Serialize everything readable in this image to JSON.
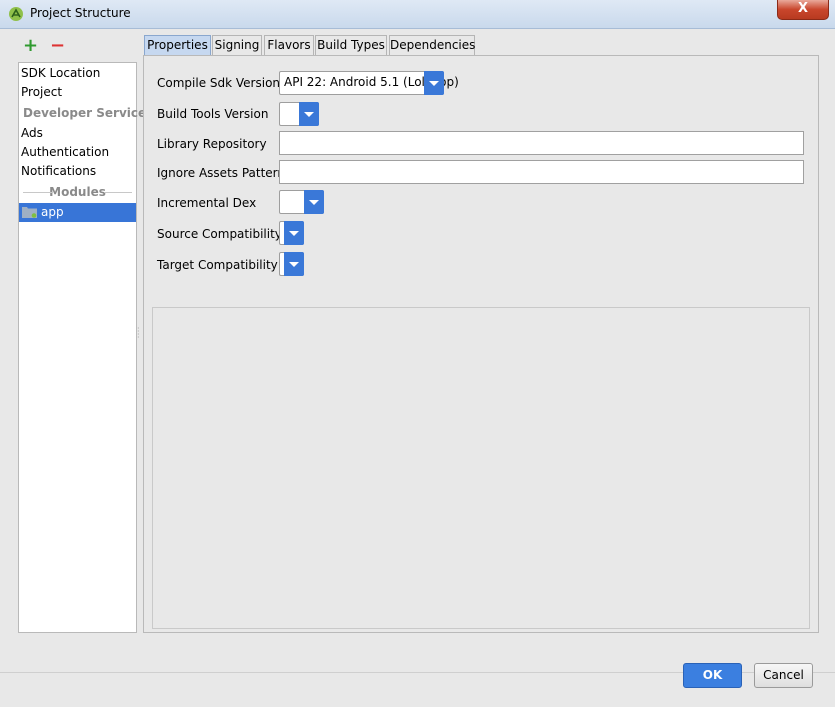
{
  "window": {
    "title": "Project Structure",
    "close_label": "X"
  },
  "toolbar": {
    "add_label": "+",
    "remove_label": "−"
  },
  "sidebar": {
    "items": [
      {
        "label": "SDK Location"
      },
      {
        "label": "Project"
      },
      {
        "label": "Developer Services"
      },
      {
        "label": "Ads"
      },
      {
        "label": "Authentication"
      },
      {
        "label": "Notifications"
      }
    ],
    "modules_header": "Modules",
    "modules": [
      {
        "label": "app",
        "selected": true
      }
    ]
  },
  "tabs": [
    {
      "label": "Properties",
      "active": true
    },
    {
      "label": "Signing"
    },
    {
      "label": "Flavors"
    },
    {
      "label": "Build Types"
    },
    {
      "label": "Dependencies"
    }
  ],
  "properties": {
    "compile_sdk": {
      "label": "Compile Sdk Version",
      "value": "API 22: Android 5.1 (Lollipop)"
    },
    "build_tools": {
      "label": "Build Tools Version",
      "value": ""
    },
    "library_repository": {
      "label": "Library Repository",
      "value": ""
    },
    "ignore_assets": {
      "label": "Ignore Assets Pattern",
      "value": ""
    },
    "incremental_dex": {
      "label": "Incremental Dex",
      "value": ""
    },
    "source_compat": {
      "label": "Source Compatibility",
      "value": ""
    },
    "target_compat": {
      "label": "Target Compatibility",
      "value": ""
    }
  },
  "buttons": {
    "ok": "OK",
    "cancel": "Cancel"
  },
  "colors": {
    "accent": "#3b7fe0",
    "selection": "#3875d7"
  }
}
